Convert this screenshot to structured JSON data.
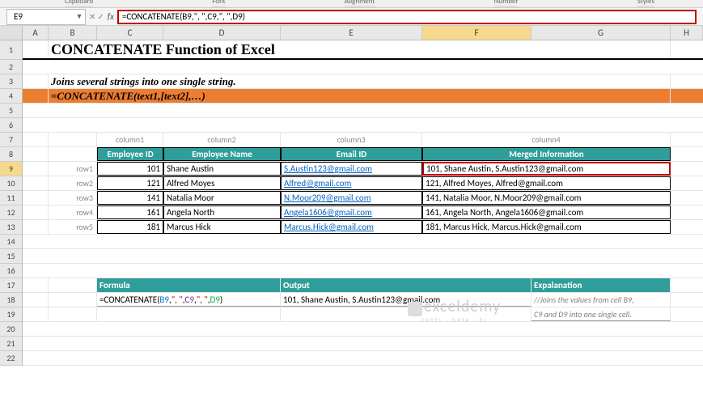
{
  "namebox": "E9",
  "formula_bar": "=CONCATENATE(B9,\", \",C9,\", \",D9)",
  "ribbon_edge": {
    "left": "Clipboard",
    "mid1": "Font",
    "mid2": "Alignment",
    "mid3": "Number",
    "right": "Styles"
  },
  "columns": [
    "A",
    "B",
    "C",
    "D",
    "E",
    "F",
    "G",
    "H"
  ],
  "rows": [
    "1",
    "2",
    "3",
    "4",
    "5",
    "6",
    "7",
    "8",
    "9",
    "10",
    "11",
    "12",
    "13",
    "14",
    "15",
    "16",
    "17",
    "18",
    "19",
    "20",
    "21",
    "22"
  ],
  "title": "CONCATENATE Function of Excel",
  "subtitle": "Joins several strings into one single string.",
  "syntax": "=CONCATENATE(text1,[text2],…)",
  "col_labels": [
    "column1",
    "column2",
    "column3",
    "column4"
  ],
  "row_labels": [
    "row1",
    "row2",
    "row3",
    "row4",
    "row5"
  ],
  "table": {
    "headers": [
      "Employee ID",
      "Employee Name",
      "Email ID",
      "Merged Information"
    ],
    "rows": [
      {
        "id": "101",
        "name": "Shane Austin",
        "email": "S.Austin123@gmail.com",
        "merged": "101, Shane Austin, S.Austin123@gmail.com"
      },
      {
        "id": "121",
        "name": "Alfred Moyes",
        "email": "Alfred@gmail.com",
        "merged": "121, Alfred Moyes, Alfred@gmail.com"
      },
      {
        "id": "141",
        "name": "Natalia Moor",
        "email": "N.Moor209@gmail.com",
        "merged": "141, Natalia Moor, N.Moor209@gmail.com"
      },
      {
        "id": "161",
        "name": "Angela North",
        "email": "Angela1606@gmail.com",
        "merged": "161, Angela North, Angela1606@gmail.com"
      },
      {
        "id": "181",
        "name": "Marcus Hick",
        "email": "Marcus.Hick@gmail.com",
        "merged": "181, Marcus Hick, Marcus.Hick@gmail.com"
      }
    ]
  },
  "section": {
    "headers": [
      "Formula",
      "Output",
      "Expalanation"
    ],
    "formula": "=CONCATENATE(B9,\", \",C9,\", \",D9)",
    "output": "101, Shane Austin, S.Austin123@gmail.com",
    "explain1": "//Joins the values from cell B9,",
    "explain2": "C9 and D9 into one single cell."
  },
  "watermark": {
    "main": "exceldemy",
    "sub": "EXCEL · DATA · BI"
  }
}
